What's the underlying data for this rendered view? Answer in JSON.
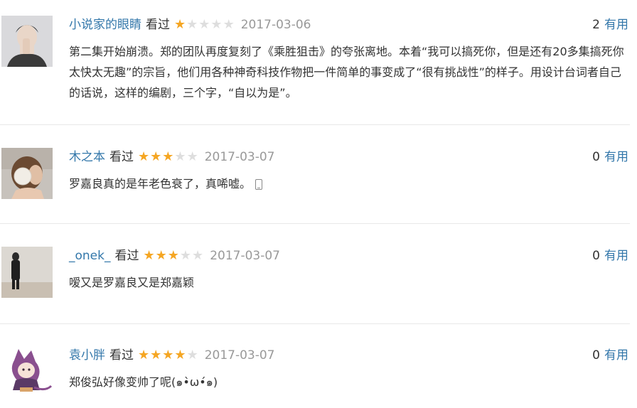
{
  "reviews": [
    {
      "author": "小说家的眼睛",
      "watched": "看过",
      "rating": 1,
      "date": "2017-03-06",
      "useful_count": "2",
      "useful_label": "有用",
      "content": "第二集开始崩溃。郑的团队再度复刻了《乘胜狙击》的夸张离地。本着“我可以搞死你，但是还有20多集搞死你太快太无趣”的宗旨，他们用各种神奇科技作物把一件简单的事变成了“很有挑战性”的样子。用设计台词者自己的话说，这样的编剧，三个字，“自以为是”。",
      "from_mobile": false
    },
    {
      "author": "木之本",
      "watched": "看过",
      "rating": 3,
      "date": "2017-03-07",
      "useful_count": "0",
      "useful_label": "有用",
      "content": "罗嘉良真的是年老色衰了，真唏嘘。",
      "from_mobile": true
    },
    {
      "author": "_onek_",
      "watched": "看过",
      "rating": 3,
      "date": "2017-03-07",
      "useful_count": "0",
      "useful_label": "有用",
      "content": "嗳又是罗嘉良又是郑嘉颖",
      "from_mobile": false
    },
    {
      "author": "袁小胖",
      "watched": "看过",
      "rating": 4,
      "date": "2017-03-07",
      "useful_count": "0",
      "useful_label": "有用",
      "content": "郑俊弘好像变帅了呢(๑•̀ω•́๑)",
      "from_mobile": false
    }
  ],
  "colors": {
    "link": "#3377aa",
    "star_on": "#f5a623",
    "star_off": "#dedede",
    "date": "#999999"
  },
  "icons": {
    "mobile": "phone-icon",
    "star": "star-icon"
  }
}
